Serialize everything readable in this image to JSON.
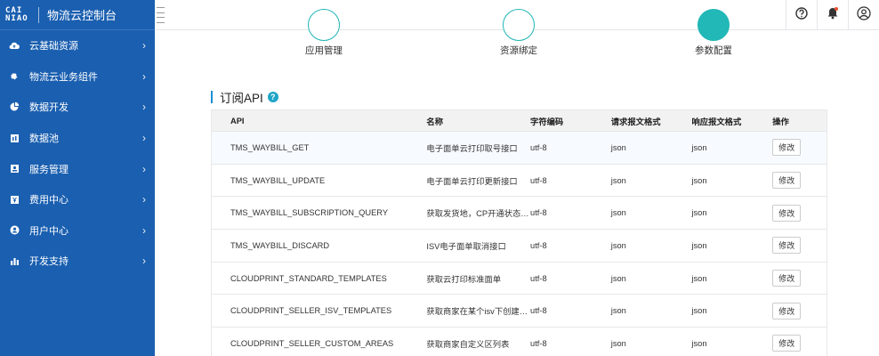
{
  "brand": {
    "logo_line1": "CAI",
    "logo_line2": "NIAO",
    "title": "物流云控制台"
  },
  "sidebar": {
    "items": [
      {
        "label": "云基础资源",
        "icon": "cloud-icon"
      },
      {
        "label": "物流云业务组件",
        "icon": "puzzle-icon"
      },
      {
        "label": "数据开发",
        "icon": "pie-chart-icon"
      },
      {
        "label": "数据池",
        "icon": "database-icon"
      },
      {
        "label": "服务管理",
        "icon": "service-icon"
      },
      {
        "label": "费用中心",
        "icon": "billing-icon"
      },
      {
        "label": "用户中心",
        "icon": "user-icon"
      },
      {
        "label": "开发支持",
        "icon": "bar-chart-icon"
      }
    ]
  },
  "topbar": {
    "icons": [
      "help-icon",
      "notification-bell-icon",
      "account-avatar-icon"
    ]
  },
  "steps": [
    {
      "label": "应用管理",
      "done": false
    },
    {
      "label": "资源绑定",
      "done": false
    },
    {
      "label": "参数配置",
      "done": true
    }
  ],
  "section": {
    "title": "订阅API",
    "help": "?"
  },
  "table": {
    "headers": {
      "api": "API",
      "name": "名称",
      "encoding": "字符编码",
      "req": "请求报文格式",
      "res": "响应报文格式",
      "op": "操作"
    },
    "rows": [
      {
        "api": "TMS_WAYBILL_GET",
        "name": "电子面单云打印取号接口",
        "encoding": "utf-8",
        "req": "json",
        "res": "json",
        "op": "修改"
      },
      {
        "api": "TMS_WAYBILL_UPDATE",
        "name": "电子面单云打印更新接口",
        "encoding": "utf-8",
        "req": "json",
        "res": "json",
        "op": "修改"
      },
      {
        "api": "TMS_WAYBILL_SUBSCRIPTION_QUERY",
        "name": "获取发货地，CP开通状态…",
        "encoding": "utf-8",
        "req": "json",
        "res": "json",
        "op": "修改"
      },
      {
        "api": "TMS_WAYBILL_DISCARD",
        "name": "ISV电子面单取消接口",
        "encoding": "utf-8",
        "req": "json",
        "res": "json",
        "op": "修改"
      },
      {
        "api": "CLOUDPRINT_STANDARD_TEMPLATES",
        "name": "获取云打印标准面单",
        "encoding": "utf-8",
        "req": "json",
        "res": "json",
        "op": "修改"
      },
      {
        "api": "CLOUDPRINT_SELLER_ISV_TEMPLATES",
        "name": "获取商家在某个isv下创建…",
        "encoding": "utf-8",
        "req": "json",
        "res": "json",
        "op": "修改"
      },
      {
        "api": "CLOUDPRINT_SELLER_CUSTOM_AREAS",
        "name": "获取商家自定义区列表",
        "encoding": "utf-8",
        "req": "json",
        "res": "json",
        "op": "修改"
      }
    ]
  },
  "colors": {
    "sidebar": "#1a5fb0",
    "accent": "#22b8b8",
    "section_bar": "#1a8fd8"
  }
}
